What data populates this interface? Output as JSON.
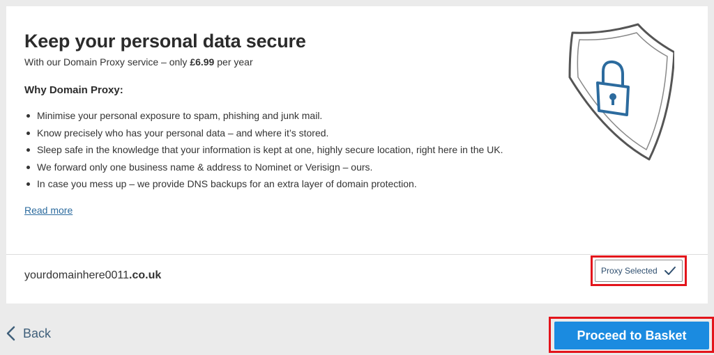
{
  "header": {
    "title": "Keep your personal data secure",
    "subtitle_prefix": "With our Domain Proxy service – only ",
    "subtitle_price": "£6.99",
    "subtitle_suffix": " per year"
  },
  "why": {
    "heading": "Why Domain Proxy:",
    "bullets": [
      "Minimise your personal exposure to spam, phishing and junk mail.",
      "Know precisely who has your personal data – and where it’s stored.",
      "Sleep safe in the knowledge that your information is kept at one, highly secure location, right here in the UK.",
      "We forward only one business name & address to Nominet or Verisign – ours.",
      "In case you mess up – we provide DNS backups for an extra layer of domain protection."
    ],
    "read_more": "Read more"
  },
  "illustration": {
    "icon": "shield-lock-icon",
    "shield_color": "#555555",
    "lock_color": "#2c6b9e"
  },
  "domain_row": {
    "name": "yourdomainhere0011",
    "tld": ".co.uk",
    "proxy_button_label": "Proxy Selected",
    "proxy_icon": "check-icon"
  },
  "footer": {
    "back_label": "Back",
    "back_icon": "chevron-left-icon",
    "proceed_label": "Proceed to Basket",
    "proceed_color": "#1b8be0",
    "highlight_color": "#e3141b"
  }
}
